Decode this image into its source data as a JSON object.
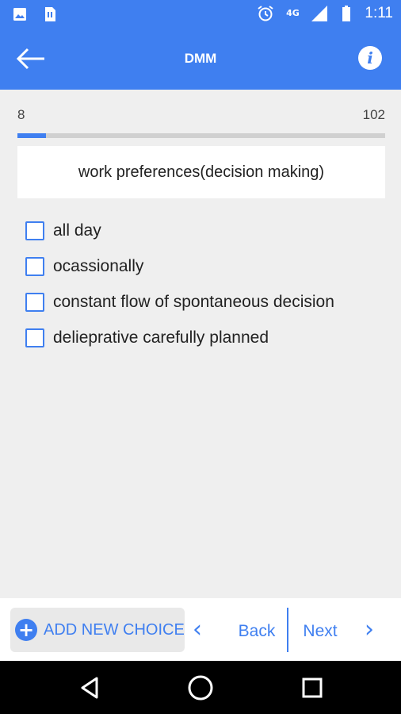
{
  "status_bar": {
    "left_icons": [
      "image-icon",
      "sim-card-icon"
    ],
    "right_icons": [
      "alarm-icon",
      "network-4g-icon",
      "signal-icon",
      "battery-icon"
    ],
    "network_label": "4G",
    "time": "1:11"
  },
  "app_bar": {
    "title": "DMM",
    "back_icon": "arrow-left-icon",
    "info_icon": "info-icon",
    "info_glyph": "i"
  },
  "progress": {
    "current_label": "8",
    "total_label": "102",
    "fraction": 0.078
  },
  "question": {
    "text": "work preferences(decision making)"
  },
  "choices": [
    {
      "label": "all day",
      "checked": false
    },
    {
      "label": "ocassionally",
      "checked": false
    },
    {
      "label": "constant flow of spontaneous decision",
      "checked": false
    },
    {
      "label": "delieprative carefully planned",
      "checked": false
    }
  ],
  "bottom_bar": {
    "add_choice_label": "ADD NEW CHOICE",
    "add_choice_glyph": "+",
    "back_label": "Back",
    "next_label": "Next",
    "prev_glyph": "‹",
    "next_glyph": "›"
  },
  "colors": {
    "accent": "#3f7ff0",
    "background": "#efefef"
  }
}
